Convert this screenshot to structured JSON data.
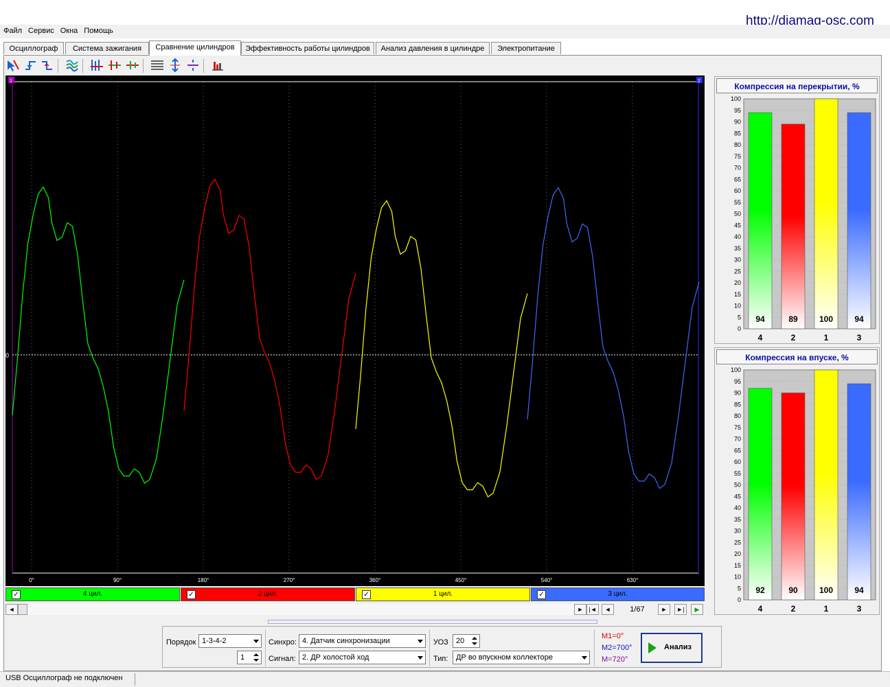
{
  "site_link": "http://diamag-osc.com",
  "menu": [
    "Файл",
    "Сервис",
    "Окна",
    "Помощь"
  ],
  "tabs": [
    {
      "label": "Осциллограф"
    },
    {
      "label": "Система зажигания"
    },
    {
      "label": "Сравнение цилиндров",
      "active": true
    },
    {
      "label": "Эффективность работы цилиндров"
    },
    {
      "label": "Анализ давления в цилиндре"
    },
    {
      "label": "Электропитание"
    }
  ],
  "toolbar_icons": [
    "cursor-icon",
    "rise-edge-icon",
    "fall-edge-icon",
    "channels-icon",
    "align-peaks-icon",
    "align-center-icon",
    "align-low-icon",
    "grid-lines-icon",
    "zoom-vertical-icon",
    "center-line-icon",
    "bar-chart-icon"
  ],
  "scope": {
    "zero_label": "0",
    "marker1": "1",
    "marker2": "2",
    "degree_ticks": [
      "0°",
      "90°",
      "180°",
      "270°",
      "360°",
      "450°",
      "540°",
      "630°"
    ]
  },
  "channels": [
    {
      "label": "4 цил.",
      "color": "#00ff00",
      "checked": true
    },
    {
      "label": "2 цил.",
      "color": "#ff0000",
      "checked": true
    },
    {
      "label": "1 цил.",
      "color": "#ffff00",
      "checked": true
    },
    {
      "label": "3 цил.",
      "color": "#3a6bff",
      "checked": true
    }
  ],
  "page_counter": "1/67",
  "chart_data": [
    {
      "type": "bar",
      "title": "Компрессия на перекрытии, %",
      "categories": [
        "4",
        "2",
        "1",
        "3"
      ],
      "values": [
        94,
        89,
        100,
        94
      ],
      "colors": [
        "#00ff00",
        "#ff0000",
        "#ffff00",
        "#3a6bff"
      ],
      "ylim": [
        0,
        100
      ],
      "yticks": [
        "0",
        "5",
        "10",
        "15",
        "20",
        "25",
        "30",
        "35",
        "40",
        "45",
        "50",
        "55",
        "60",
        "65",
        "70",
        "75",
        "80",
        "85",
        "90",
        "95",
        "100"
      ]
    },
    {
      "type": "bar",
      "title": "Компрессия на впуске, %",
      "categories": [
        "4",
        "2",
        "1",
        "3"
      ],
      "values": [
        92,
        90,
        100,
        94
      ],
      "colors": [
        "#00ff00",
        "#ff0000",
        "#ffff00",
        "#3a6bff"
      ],
      "ylim": [
        0,
        100
      ],
      "yticks": [
        "0",
        "5",
        "10",
        "15",
        "20",
        "25",
        "30",
        "35",
        "40",
        "45",
        "50",
        "55",
        "60",
        "65",
        "70",
        "75",
        "80",
        "85",
        "90",
        "95",
        "100"
      ]
    }
  ],
  "controls": {
    "order_label": "Порядок",
    "order_value": "1-3-4-2",
    "order_num": "1",
    "sync_label": "Синхро:",
    "sync_value": "4.  Датчик синхронизации",
    "signal_label": "Сигнал:",
    "signal_value": "2.  ДР холостой ход",
    "uoz_label": "УОЗ",
    "uoz_value": "20",
    "type_label": "Тип:",
    "type_value": "ДР во впускном коллекторе",
    "m1": "M1=0°",
    "m2": "M2=700°",
    "m": "M=720°",
    "analyze_label": "Анализ"
  },
  "status": "USB Осциллограф не подключен"
}
